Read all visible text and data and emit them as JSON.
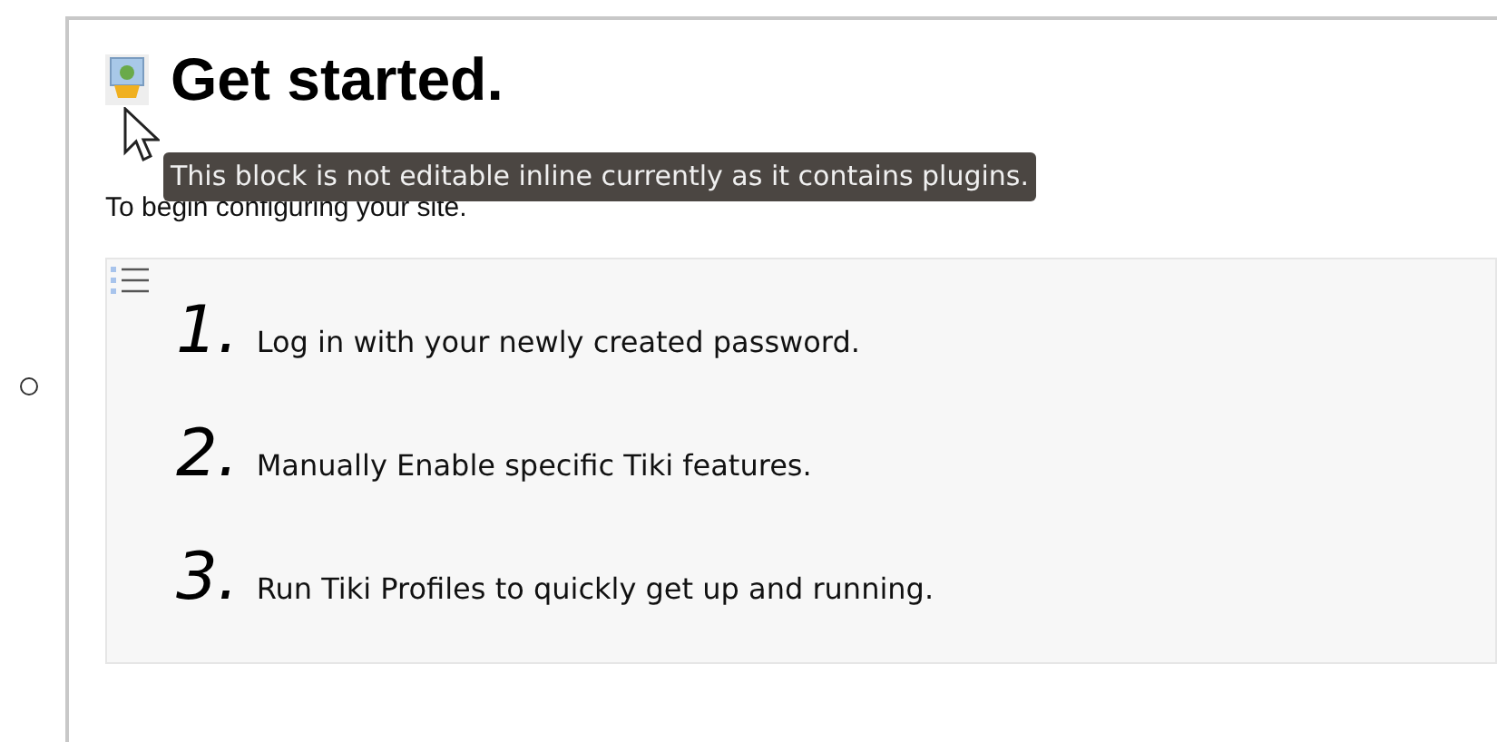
{
  "heading": "Get started.",
  "tooltip": "This block is not editable inline currently as it contains plugins.",
  "intro": "To begin configuring your site.",
  "steps": [
    {
      "number": "1.",
      "text": "Log in with your newly created password."
    },
    {
      "number": "2.",
      "text": "Manually Enable specific Tiki features."
    },
    {
      "number": "3.",
      "text": "Run Tiki Profiles to quickly get up and running."
    }
  ]
}
